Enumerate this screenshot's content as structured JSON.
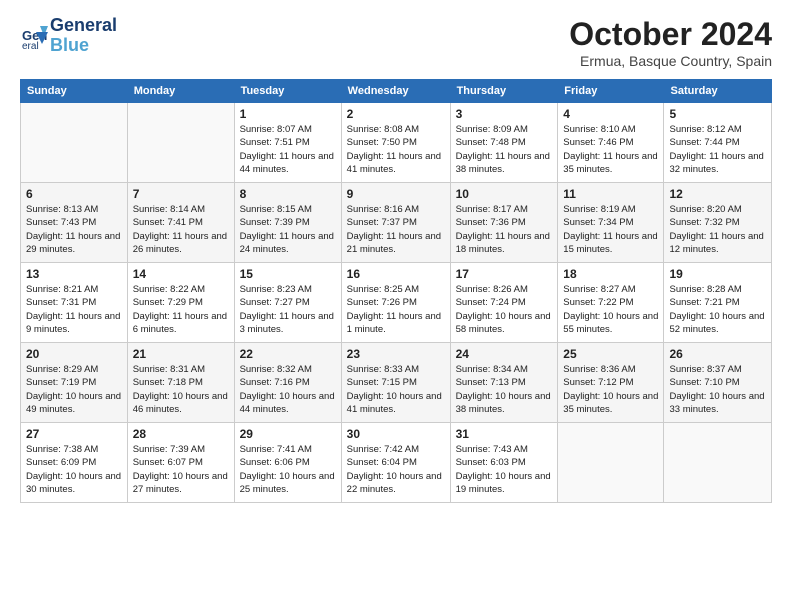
{
  "header": {
    "logo_line1": "General",
    "logo_line2": "Blue",
    "month": "October 2024",
    "location": "Ermua, Basque Country, Spain"
  },
  "weekdays": [
    "Sunday",
    "Monday",
    "Tuesday",
    "Wednesday",
    "Thursday",
    "Friday",
    "Saturday"
  ],
  "weeks": [
    [
      {
        "day": "",
        "info": ""
      },
      {
        "day": "",
        "info": ""
      },
      {
        "day": "1",
        "info": "Sunrise: 8:07 AM\nSunset: 7:51 PM\nDaylight: 11 hours and 44 minutes."
      },
      {
        "day": "2",
        "info": "Sunrise: 8:08 AM\nSunset: 7:50 PM\nDaylight: 11 hours and 41 minutes."
      },
      {
        "day": "3",
        "info": "Sunrise: 8:09 AM\nSunset: 7:48 PM\nDaylight: 11 hours and 38 minutes."
      },
      {
        "day": "4",
        "info": "Sunrise: 8:10 AM\nSunset: 7:46 PM\nDaylight: 11 hours and 35 minutes."
      },
      {
        "day": "5",
        "info": "Sunrise: 8:12 AM\nSunset: 7:44 PM\nDaylight: 11 hours and 32 minutes."
      }
    ],
    [
      {
        "day": "6",
        "info": "Sunrise: 8:13 AM\nSunset: 7:43 PM\nDaylight: 11 hours and 29 minutes."
      },
      {
        "day": "7",
        "info": "Sunrise: 8:14 AM\nSunset: 7:41 PM\nDaylight: 11 hours and 26 minutes."
      },
      {
        "day": "8",
        "info": "Sunrise: 8:15 AM\nSunset: 7:39 PM\nDaylight: 11 hours and 24 minutes."
      },
      {
        "day": "9",
        "info": "Sunrise: 8:16 AM\nSunset: 7:37 PM\nDaylight: 11 hours and 21 minutes."
      },
      {
        "day": "10",
        "info": "Sunrise: 8:17 AM\nSunset: 7:36 PM\nDaylight: 11 hours and 18 minutes."
      },
      {
        "day": "11",
        "info": "Sunrise: 8:19 AM\nSunset: 7:34 PM\nDaylight: 11 hours and 15 minutes."
      },
      {
        "day": "12",
        "info": "Sunrise: 8:20 AM\nSunset: 7:32 PM\nDaylight: 11 hours and 12 minutes."
      }
    ],
    [
      {
        "day": "13",
        "info": "Sunrise: 8:21 AM\nSunset: 7:31 PM\nDaylight: 11 hours and 9 minutes."
      },
      {
        "day": "14",
        "info": "Sunrise: 8:22 AM\nSunset: 7:29 PM\nDaylight: 11 hours and 6 minutes."
      },
      {
        "day": "15",
        "info": "Sunrise: 8:23 AM\nSunset: 7:27 PM\nDaylight: 11 hours and 3 minutes."
      },
      {
        "day": "16",
        "info": "Sunrise: 8:25 AM\nSunset: 7:26 PM\nDaylight: 11 hours and 1 minute."
      },
      {
        "day": "17",
        "info": "Sunrise: 8:26 AM\nSunset: 7:24 PM\nDaylight: 10 hours and 58 minutes."
      },
      {
        "day": "18",
        "info": "Sunrise: 8:27 AM\nSunset: 7:22 PM\nDaylight: 10 hours and 55 minutes."
      },
      {
        "day": "19",
        "info": "Sunrise: 8:28 AM\nSunset: 7:21 PM\nDaylight: 10 hours and 52 minutes."
      }
    ],
    [
      {
        "day": "20",
        "info": "Sunrise: 8:29 AM\nSunset: 7:19 PM\nDaylight: 10 hours and 49 minutes."
      },
      {
        "day": "21",
        "info": "Sunrise: 8:31 AM\nSunset: 7:18 PM\nDaylight: 10 hours and 46 minutes."
      },
      {
        "day": "22",
        "info": "Sunrise: 8:32 AM\nSunset: 7:16 PM\nDaylight: 10 hours and 44 minutes."
      },
      {
        "day": "23",
        "info": "Sunrise: 8:33 AM\nSunset: 7:15 PM\nDaylight: 10 hours and 41 minutes."
      },
      {
        "day": "24",
        "info": "Sunrise: 8:34 AM\nSunset: 7:13 PM\nDaylight: 10 hours and 38 minutes."
      },
      {
        "day": "25",
        "info": "Sunrise: 8:36 AM\nSunset: 7:12 PM\nDaylight: 10 hours and 35 minutes."
      },
      {
        "day": "26",
        "info": "Sunrise: 8:37 AM\nSunset: 7:10 PM\nDaylight: 10 hours and 33 minutes."
      }
    ],
    [
      {
        "day": "27",
        "info": "Sunrise: 7:38 AM\nSunset: 6:09 PM\nDaylight: 10 hours and 30 minutes."
      },
      {
        "day": "28",
        "info": "Sunrise: 7:39 AM\nSunset: 6:07 PM\nDaylight: 10 hours and 27 minutes."
      },
      {
        "day": "29",
        "info": "Sunrise: 7:41 AM\nSunset: 6:06 PM\nDaylight: 10 hours and 25 minutes."
      },
      {
        "day": "30",
        "info": "Sunrise: 7:42 AM\nSunset: 6:04 PM\nDaylight: 10 hours and 22 minutes."
      },
      {
        "day": "31",
        "info": "Sunrise: 7:43 AM\nSunset: 6:03 PM\nDaylight: 10 hours and 19 minutes."
      },
      {
        "day": "",
        "info": ""
      },
      {
        "day": "",
        "info": ""
      }
    ]
  ]
}
